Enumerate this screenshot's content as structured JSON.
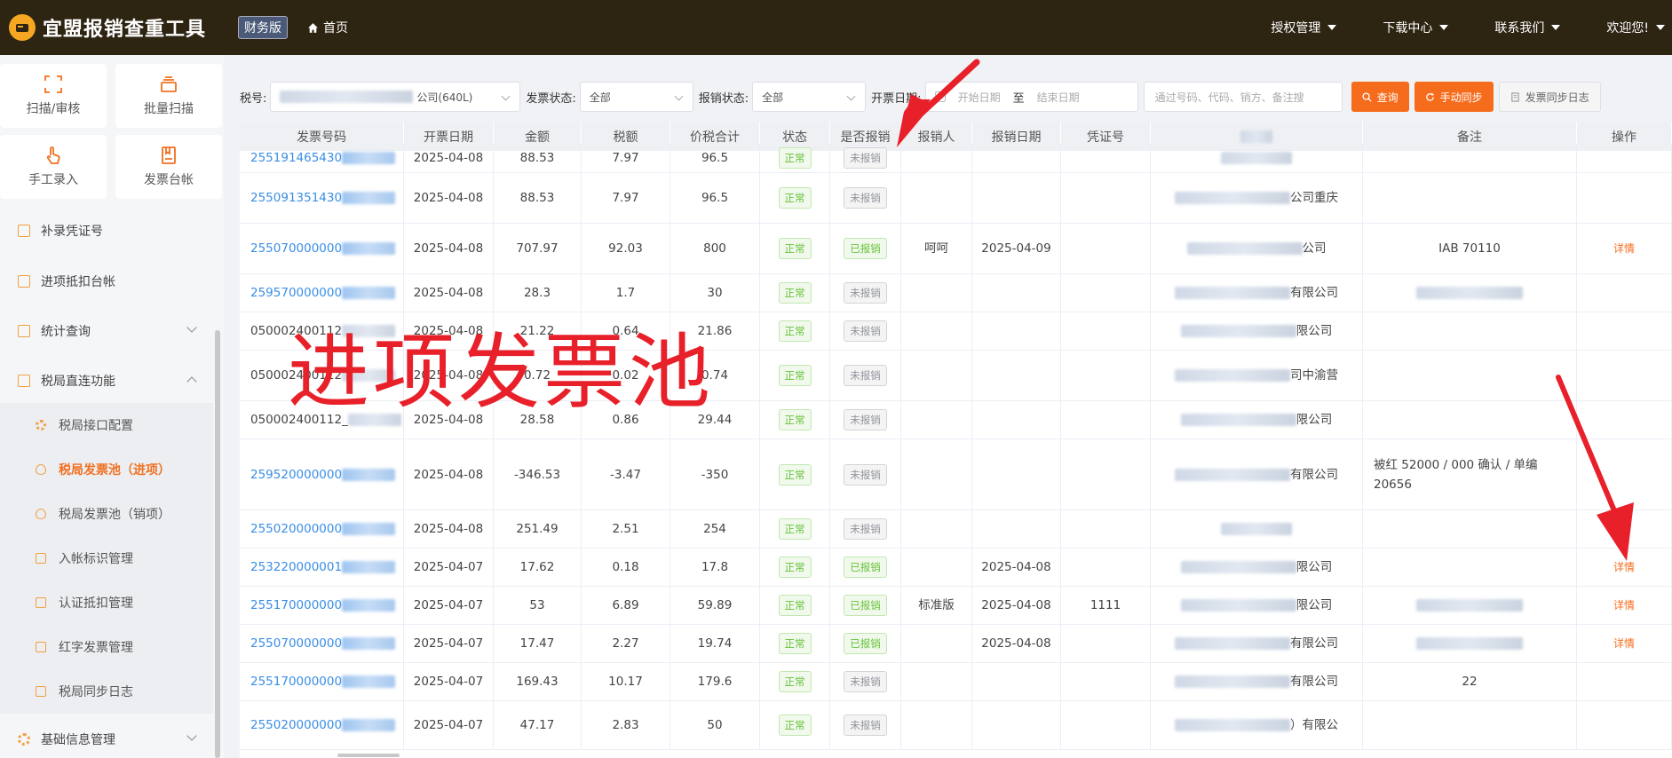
{
  "header": {
    "app_title": "宜盟报销查重工具",
    "edition": "财务版",
    "home": "首页",
    "nav": [
      {
        "label": "授权管理"
      },
      {
        "label": "下载中心"
      },
      {
        "label": "联系我们"
      },
      {
        "label": "欢迎您!"
      }
    ]
  },
  "sidebar": {
    "tiles": [
      {
        "label": "扫描/审核",
        "icon": "scan-icon"
      },
      {
        "label": "批量扫描",
        "icon": "stack-icon"
      },
      {
        "label": "手工录入",
        "icon": "hand-icon"
      },
      {
        "label": "发票台帐",
        "icon": "book-icon"
      }
    ],
    "menu": [
      {
        "label": "补录凭证号"
      },
      {
        "label": "进项抵扣台帐"
      },
      {
        "label": "统计查询"
      },
      {
        "label": "税局直连功能"
      }
    ],
    "submenu": [
      {
        "label": "税局接口配置"
      },
      {
        "label": "税局发票池（进项）"
      },
      {
        "label": "税局发票池（销项）"
      },
      {
        "label": "入帐标识管理"
      },
      {
        "label": "认证抵扣管理"
      },
      {
        "label": "红字发票管理"
      },
      {
        "label": "税局同步日志"
      }
    ],
    "bottom_menu": {
      "label": "基础信息管理"
    }
  },
  "filters": {
    "tax_no_label": "税号:",
    "tax_no_value": "公司(640L)",
    "invoice_status_label": "发票状态:",
    "invoice_status_value": "全部",
    "reimb_status_label": "报销状态:",
    "reimb_status_value": "全部",
    "date_label": "开票日期:",
    "date_start_placeholder": "开始日期",
    "date_sep": "至",
    "date_end_placeholder": "结束日期",
    "search_placeholder": "通过号码、代码、销方、备注搜",
    "query_button": "查询",
    "sync_button": "手动同步",
    "log_button": "发票同步日志"
  },
  "table": {
    "headers": [
      "发票号码",
      "开票日期",
      "金额",
      "税额",
      "价税合计",
      "状态",
      "是否报销",
      "报销人",
      "报销日期",
      "凭证号",
      "",
      "备注",
      "操作"
    ],
    "rows": [
      {
        "no": "255191465430",
        "link": true,
        "date": "2025-04-08",
        "amount": "88.53",
        "tax": "7.97",
        "total": "96.5",
        "status": "正常",
        "reimb": "未报销",
        "person": "",
        "rdate": "",
        "voucher": "",
        "seller": "",
        "remark": "",
        "op": ""
      },
      {
        "no": "255091351430",
        "link": true,
        "date": "2025-04-08",
        "amount": "88.53",
        "tax": "7.97",
        "total": "96.5",
        "status": "正常",
        "reimb": "未报销",
        "person": "",
        "rdate": "",
        "voucher": "",
        "seller": "公司重庆",
        "remark": "",
        "op": ""
      },
      {
        "no": "255070000000",
        "link": true,
        "date": "2025-04-08",
        "amount": "707.97",
        "tax": "92.03",
        "total": "800",
        "status": "正常",
        "reimb": "已报销",
        "person": "呵呵",
        "rdate": "2025-04-09",
        "voucher": "",
        "seller": "公司",
        "remark": "IAB  70110",
        "op": "详情"
      },
      {
        "no": "259570000000",
        "link": true,
        "date": "2025-04-08",
        "amount": "28.3",
        "tax": "1.7",
        "total": "30",
        "status": "正常",
        "reimb": "未报销",
        "person": "",
        "rdate": "",
        "voucher": "",
        "seller": "有限公司",
        "remark": "",
        "op": ""
      },
      {
        "no": "050002400112",
        "link": false,
        "date": "2025-04-08",
        "amount": "21.22",
        "tax": "0.64",
        "total": "21.86",
        "status": "正常",
        "reimb": "未报销",
        "person": "",
        "rdate": "",
        "voucher": "",
        "seller": "限公司",
        "remark": "",
        "op": ""
      },
      {
        "no": "050002400112",
        "link": false,
        "date": "2025-04-08",
        "amount": "0.72",
        "tax": "0.02",
        "total": "0.74",
        "status": "正常",
        "reimb": "未报销",
        "person": "",
        "rdate": "",
        "voucher": "",
        "seller": "司中渝营",
        "remark": "",
        "op": ""
      },
      {
        "no": "050002400112_",
        "link": false,
        "date": "2025-04-08",
        "amount": "28.58",
        "tax": "0.86",
        "total": "29.44",
        "status": "正常",
        "reimb": "未报销",
        "person": "",
        "rdate": "",
        "voucher": "",
        "seller": "限公司",
        "remark": "",
        "op": ""
      },
      {
        "no": "259520000000",
        "link": true,
        "date": "2025-04-08",
        "amount": "-346.53",
        "tax": "-3.47",
        "total": "-350",
        "status": "正常",
        "reimb": "未报销",
        "person": "",
        "rdate": "",
        "voucher": "",
        "seller": "有限公司",
        "remark": "被红 52000 / 000 确认 / 单编 20656",
        "op": ""
      },
      {
        "no": "255020000000",
        "link": true,
        "date": "2025-04-08",
        "amount": "251.49",
        "tax": "2.51",
        "total": "254",
        "status": "正常",
        "reimb": "未报销",
        "person": "",
        "rdate": "",
        "voucher": "",
        "seller": "",
        "remark": "",
        "op": ""
      },
      {
        "no": "253220000001",
        "link": true,
        "date": "2025-04-07",
        "amount": "17.62",
        "tax": "0.18",
        "total": "17.8",
        "status": "正常",
        "reimb": "已报销",
        "person": "",
        "rdate": "2025-04-08",
        "voucher": "",
        "seller": "限公司",
        "remark": "",
        "op": "详情"
      },
      {
        "no": "255170000000",
        "link": true,
        "date": "2025-04-07",
        "amount": "53",
        "tax": "6.89",
        "total": "59.89",
        "status": "正常",
        "reimb": "已报销",
        "person": "标准版",
        "rdate": "2025-04-08",
        "voucher": "1111",
        "seller": "限公司",
        "remark": "",
        "op": "详情"
      },
      {
        "no": "255070000000",
        "link": true,
        "date": "2025-04-07",
        "amount": "17.47",
        "tax": "2.27",
        "total": "19.74",
        "status": "正常",
        "reimb": "已报销",
        "person": "",
        "rdate": "2025-04-08",
        "voucher": "",
        "seller": "有限公司",
        "remark": "",
        "op": "详情"
      },
      {
        "no": "255170000000",
        "link": true,
        "date": "2025-04-07",
        "amount": "169.43",
        "tax": "10.17",
        "total": "179.6",
        "status": "正常",
        "reimb": "未报销",
        "person": "",
        "rdate": "",
        "voucher": "",
        "seller": "有限公司",
        "remark": "22",
        "op": ""
      },
      {
        "no": "255020000000",
        "link": true,
        "date": "2025-04-07",
        "amount": "47.17",
        "tax": "2.83",
        "total": "50",
        "status": "正常",
        "reimb": "未报销",
        "person": "",
        "rdate": "",
        "voucher": "",
        "seller": "）有限公",
        "remark": "",
        "op": ""
      }
    ]
  },
  "overlay": {
    "text": "进项发票池"
  },
  "colors": {
    "accent": "#f56c1c",
    "topbar": "#2e2412",
    "annotation": "#e8202a",
    "link": "#3a8ee6"
  }
}
